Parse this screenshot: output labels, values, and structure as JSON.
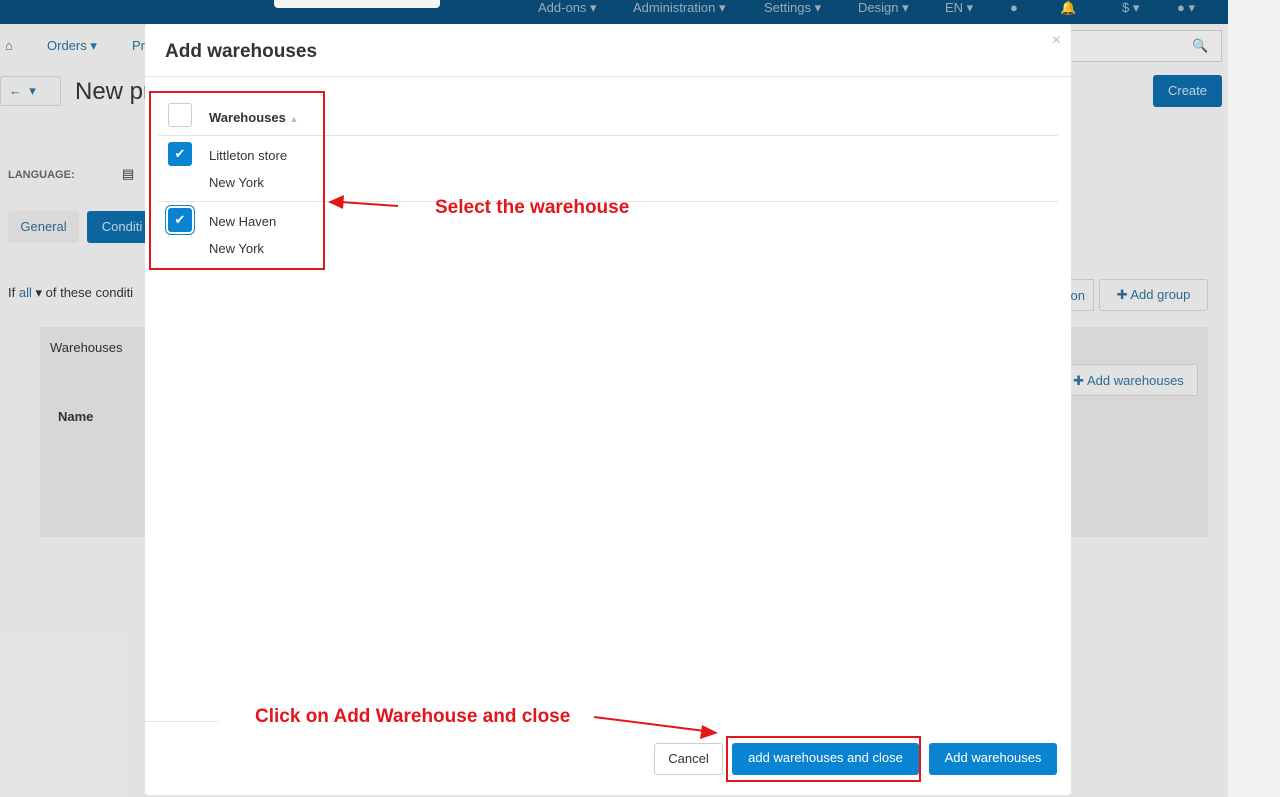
{
  "topbar": {
    "items": [
      "Add-ons",
      "Administration",
      "Settings",
      "Design",
      "EN",
      "$"
    ]
  },
  "nav": {
    "orders": "Orders",
    "products_partial": "Pr",
    "search_icon": "search-icon"
  },
  "page": {
    "title_partial": "New pr",
    "create": "Create",
    "language_label": "LANGUAGE:",
    "tab_general": "General",
    "tab_conditions_partial": "Conditi",
    "if": "If",
    "all": "all",
    "conditions_partial": "of these conditi",
    "add_condition_partial": "on",
    "add_group": "Add group",
    "warehouses_label": "Warehouses",
    "add_warehouses": "Add warehouses",
    "name_header": "Name"
  },
  "modal": {
    "title": "Add warehouses",
    "close": "×",
    "column_header": "Warehouses",
    "rows": [
      {
        "name": "Littleton store",
        "city": "New York",
        "checked": true
      },
      {
        "name": "New Haven",
        "city": "New York",
        "checked": true
      }
    ],
    "cancel": "Cancel",
    "add_and_close": "add warehouses and close",
    "add": "Add warehouses"
  },
  "annotations": {
    "select": "Select the warehouse",
    "click": "Click on Add Warehouse and close"
  }
}
